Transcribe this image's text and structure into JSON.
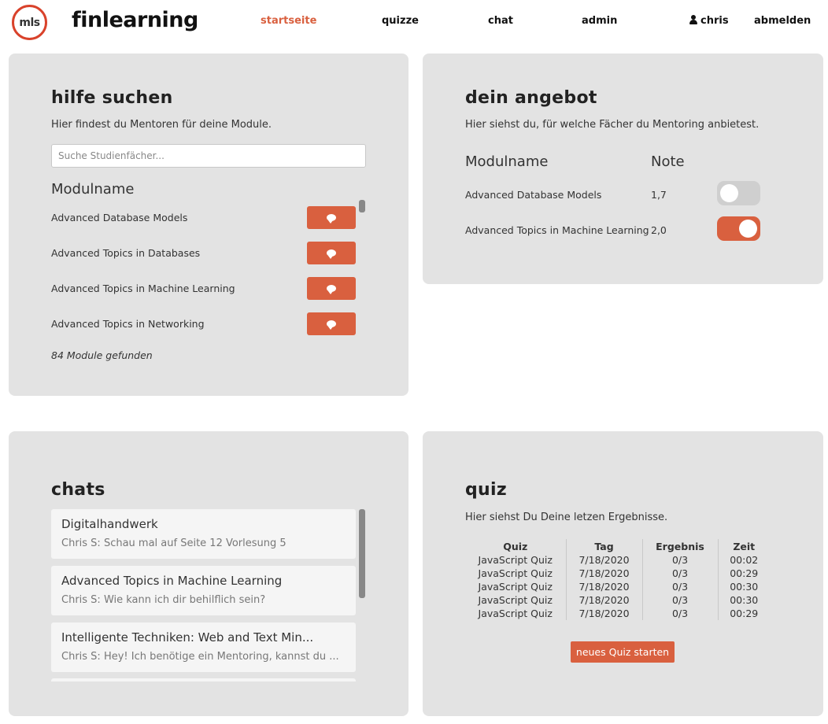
{
  "nav": {
    "logo_text": "mls",
    "brand": "finlearning",
    "links": [
      "startseite",
      "quizze",
      "chat",
      "admin"
    ],
    "user": "chris",
    "logout": "abmelden"
  },
  "hilfe": {
    "title": "hilfe suchen",
    "desc": "Hier findest du Mentoren für deine Module.",
    "search_placeholder": "Suche Studienfächer...",
    "col_modulname": "Modulname",
    "modules": [
      "Advanced Database Models",
      "Advanced Topics in Databases",
      "Advanced Topics in Machine Learning",
      "Advanced Topics in Networking"
    ],
    "found": "84 Module gefunden"
  },
  "angebot": {
    "title": "dein angebot",
    "desc": "Hier siehst du, für welche Fächer du Mentoring anbietest.",
    "col_modulname": "Modulname",
    "col_note": "Note",
    "rows": [
      {
        "name": "Advanced Database Models",
        "note": "1,7",
        "active": false
      },
      {
        "name": "Advanced Topics in Machine Learning",
        "note": "2,0",
        "active": true
      }
    ]
  },
  "chats": {
    "title": "chats",
    "items": [
      {
        "title": "Digitalhandwerk",
        "msg": "Chris S: Schau mal auf Seite 12 Vorlesung 5"
      },
      {
        "title": "Advanced Topics in Machine Learning",
        "msg": "Chris S: Wie kann ich dir behilflich sein?"
      },
      {
        "title": "Intelligente Techniken: Web and Text Min...",
        "msg": "Chris S: Hey! Ich benötige ein Mentoring, kannst du ..."
      }
    ]
  },
  "quiz": {
    "title": "quiz",
    "desc": "Hier siehst Du Deine letzen Ergebnisse.",
    "headers": [
      "Quiz",
      "Tag",
      "Ergebnis",
      "Zeit"
    ],
    "rows": [
      [
        "JavaScript Quiz",
        "7/18/2020",
        "0/3",
        "00:02"
      ],
      [
        "JavaScript Quiz",
        "7/18/2020",
        "0/3",
        "00:29"
      ],
      [
        "JavaScript Quiz",
        "7/18/2020",
        "0/3",
        "00:30"
      ],
      [
        "JavaScript Quiz",
        "7/18/2020",
        "0/3",
        "00:30"
      ],
      [
        "JavaScript Quiz",
        "7/18/2020",
        "0/3",
        "00:29"
      ]
    ],
    "button": "neues Quiz starten"
  },
  "colors": {
    "accent": "#d9603f",
    "logo_ring": "#d9422b",
    "card_bg": "#e3e3e3"
  }
}
